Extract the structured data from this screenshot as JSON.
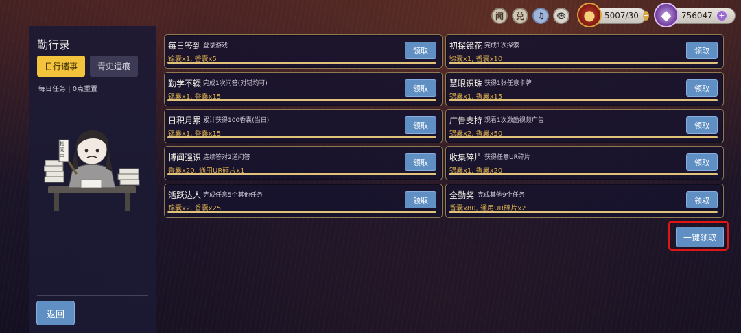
{
  "topbar": {
    "icons": [
      {
        "id": "news",
        "label": "闻",
        "icon": "news-icon"
      },
      {
        "id": "redeem",
        "label": "兑",
        "icon": "redeem-icon"
      },
      {
        "id": "music",
        "label": "♫",
        "icon": "music-icon"
      },
      {
        "id": "eye",
        "label": "👁",
        "icon": "eye-icon"
      }
    ],
    "sachet": {
      "value": "5007/30",
      "icon": "sachet-bag-icon"
    },
    "gems": {
      "value": "756047",
      "icon": "gem-icon"
    }
  },
  "panel": {
    "title": "勤行录",
    "tabs": {
      "daily": "日行诸事",
      "history": "青史遗痕"
    },
    "note": "每日任务 | 0点重置",
    "mascot_sign": "批阅中",
    "back_label": "返回"
  },
  "tasks": [
    {
      "name": "每日签到",
      "desc": "登录游戏",
      "reward": "锦囊x1, 香囊x5",
      "button": "领取",
      "progress": 1
    },
    {
      "name": "初探镜花",
      "desc": "完成1次探索",
      "reward": "锦囊x1, 香囊x10",
      "button": "领取",
      "progress": 1
    },
    {
      "name": "勤学不辍",
      "desc": "完成1次问答(对错均可)",
      "reward": "锦囊x1, 香囊x15",
      "button": "领取",
      "progress": 1
    },
    {
      "name": "慧眼识珠",
      "desc": "获得1张任意卡牌",
      "reward": "锦囊x1, 香囊x15",
      "button": "领取",
      "progress": 1
    },
    {
      "name": "日积月累",
      "desc": "累计获得100香囊(当日)",
      "reward": "锦囊x1, 香囊x15",
      "button": "领取",
      "progress": 1
    },
    {
      "name": "广告支持",
      "desc": "观看1次激励视频广告",
      "reward": "锦囊x2, 香囊x50",
      "button": "领取",
      "progress": 1
    },
    {
      "name": "博闻强识",
      "desc": "连续答对2道问答",
      "reward": "香囊x20, 通用UR碎片x1",
      "button": "领取",
      "progress": 1
    },
    {
      "name": "收集碎片",
      "desc": "获得任意UR碎片",
      "reward": "锦囊x1, 香囊x20",
      "button": "领取",
      "progress": 1
    },
    {
      "name": "活跃达人",
      "desc": "完成任意5个其他任务",
      "reward": "锦囊x2, 香囊x25",
      "button": "领取",
      "progress": 1
    },
    {
      "name": "全勤奖",
      "desc": "完成其他9个任务",
      "reward": "香囊x80, 通用UR碎片x2",
      "button": "领取",
      "progress": 1
    }
  ],
  "claim_all_label": "一键领取",
  "colors": {
    "accent_blue": "#5f8fc3",
    "tab_gold": "#f3c33b",
    "reward_gold": "#d3a84c",
    "highlight_red": "#e01616"
  }
}
